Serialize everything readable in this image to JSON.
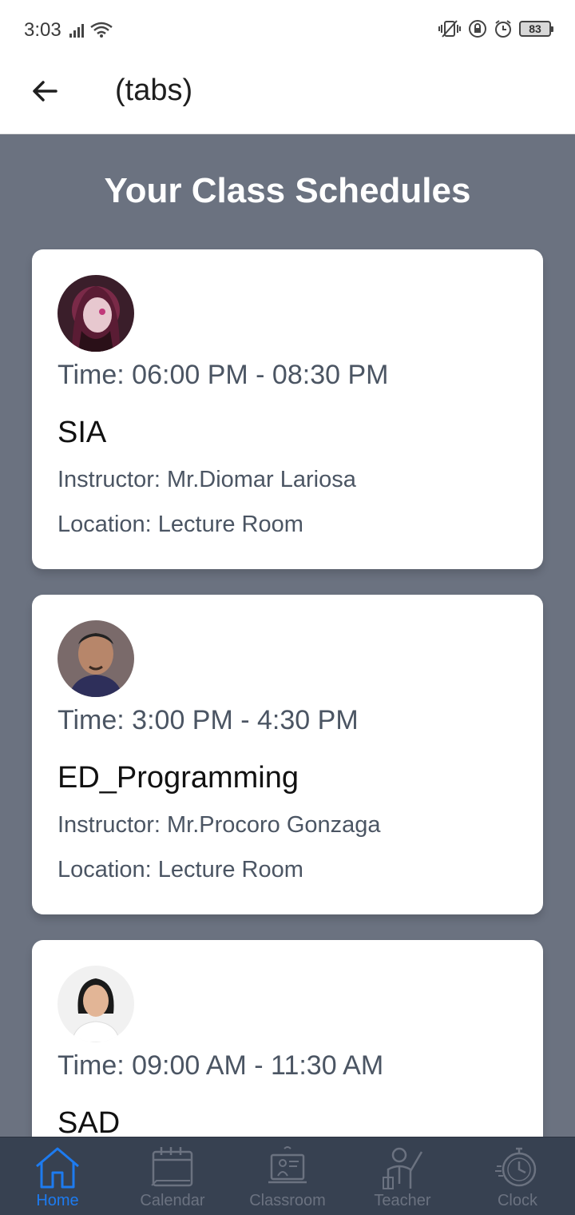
{
  "status_bar": {
    "time": "3:03",
    "battery": "83"
  },
  "app_bar": {
    "title": "(tabs)"
  },
  "page": {
    "heading": "Your Class Schedules"
  },
  "schedules": [
    {
      "time": "Time: 06:00 PM - 08:30 PM",
      "course": "SIA",
      "instructor": "Instructor: Mr.Diomar Lariosa",
      "location": "Location: Lecture Room"
    },
    {
      "time": "Time: 3:00 PM - 4:30 PM",
      "course": "ED_Programming",
      "instructor": "Instructor: Mr.Procoro Gonzaga",
      "location": "Location: Lecture Room"
    },
    {
      "time": "Time: 09:00 AM - 11:30 AM",
      "course": "SAD",
      "instructor": "",
      "location": ""
    }
  ],
  "bottom_nav": {
    "items": [
      {
        "label": "Home",
        "icon": "home-icon"
      },
      {
        "label": "Calendar",
        "icon": "calendar-icon"
      },
      {
        "label": "Classroom",
        "icon": "classroom-icon"
      },
      {
        "label": "Teacher",
        "icon": "teacher-icon"
      },
      {
        "label": "Clock",
        "icon": "clock-icon"
      }
    ],
    "active": "Home"
  },
  "colors": {
    "background": "#6b7280",
    "nav_background": "#374151",
    "active": "#1d7bf0"
  }
}
